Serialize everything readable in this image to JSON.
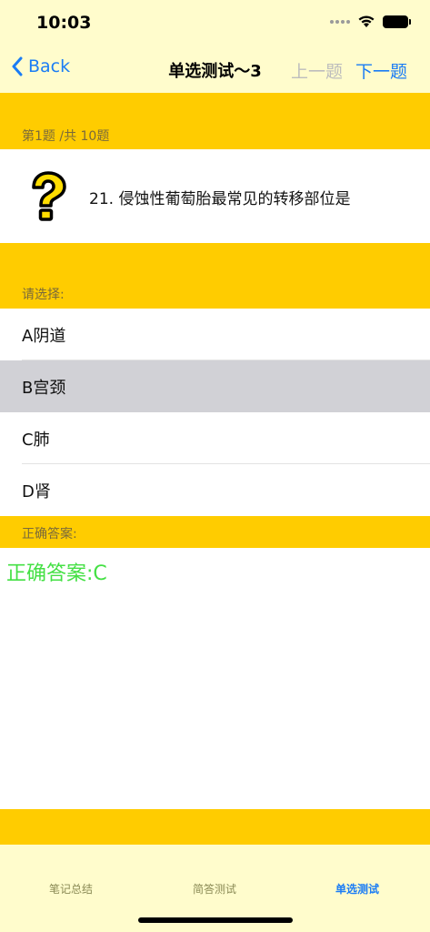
{
  "status": {
    "time": "10:03"
  },
  "nav": {
    "back_label": "Back",
    "title": "单选测试～3",
    "prev_label": "上一题",
    "next_label": "下一题"
  },
  "progress": {
    "label": "第1题 /共 10题",
    "current": 1,
    "total": 10
  },
  "question": {
    "text": "21.  侵蚀性葡萄胎最常见的转移部位是"
  },
  "choose_label": "请选择:",
  "options": [
    {
      "label": "A阴道",
      "selected": false
    },
    {
      "label": "B宫颈",
      "selected": true
    },
    {
      "label": "C肺",
      "selected": false
    },
    {
      "label": "D肾",
      "selected": false
    }
  ],
  "answer": {
    "section_label": "正确答案:",
    "text": "正确答案:C"
  },
  "tabs": [
    {
      "label": "笔记总结",
      "active": false
    },
    {
      "label": "简答测试",
      "active": false
    },
    {
      "label": "单选测试",
      "active": true
    }
  ],
  "colors": {
    "accent": "#1a7cf5",
    "section": "#ffcc00",
    "bar": "#fffccc",
    "answer": "#44e044"
  }
}
